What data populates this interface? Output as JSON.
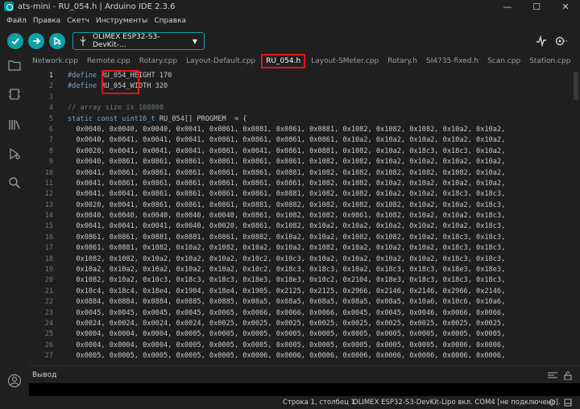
{
  "window": {
    "title": "ats-mini - RU_054.h | Arduino IDE 2.3.6",
    "minimize": "—",
    "maximize": "☐",
    "close": "✕"
  },
  "menu": [
    "Файл",
    "Правка",
    "Скетч",
    "Инструменты",
    "Справка"
  ],
  "toolbar": {
    "board": "OLIMEX ESP32-S3-DevKit-..."
  },
  "tabs": [
    {
      "label": "Network.cpp"
    },
    {
      "label": "Remote.cpp"
    },
    {
      "label": "Rotary.cpp"
    },
    {
      "label": "Layout-Default.cpp"
    },
    {
      "label": "RU_054.h",
      "active": true
    },
    {
      "label": "Layout-SMeter.cpp"
    },
    {
      "label": "Rotary.h"
    },
    {
      "label": "SI4735-fixed.h"
    },
    {
      "label": "Scan.cpp"
    },
    {
      "label": "Station.cpp"
    }
  ],
  "editor": {
    "line_numbers": [
      "1",
      "2",
      "3",
      "4",
      "5",
      "6",
      "7",
      "8",
      "9",
      "10",
      "11",
      "12",
      "13",
      "14",
      "15",
      "16",
      "17",
      "18",
      "19",
      "20",
      "21",
      "22",
      "23",
      "24",
      "25",
      "26",
      "27"
    ],
    "lines": [
      "#define RU_054_HEIGHT 170",
      "#define RU_054_WIDTH 320",
      "",
      "// array size is 108800",
      "static const uint16_t RU_054[] PROGMEM  = {",
      "  0x0040, 0x0040, 0x0040, 0x0041, 0x0861, 0x0881, 0x0861, 0x0881, 0x1082, 0x1082, 0x1082, 0x10a2, 0x10a2,",
      "  0x0040, 0x0041, 0x0041, 0x0041, 0x0861, 0x0861, 0x0861, 0x0861, 0x10a2, 0x10a2, 0x10a2, 0x10a2, 0x10a2,",
      "  0x0020, 0x0041, 0x0041, 0x0041, 0x0861, 0x0041, 0x0861, 0x0881, 0x1082, 0x10a2, 0x18c3, 0x18c3, 0x10a2,",
      "  0x0040, 0x0861, 0x0861, 0x0861, 0x0861, 0x0861, 0x0861, 0x1082, 0x1082, 0x10a2, 0x10a2, 0x10a2, 0x10a2,",
      "  0x0041, 0x0861, 0x0861, 0x0861, 0x0861, 0x0861, 0x0881, 0x1082, 0x1082, 0x1082, 0x1082, 0x1082, 0x10a2,",
      "  0x0041, 0x0861, 0x0861, 0x0861, 0x0861, 0x0861, 0x0861, 0x1082, 0x1082, 0x10a2, 0x10a2, 0x10a2, 0x10a2,",
      "  0x0041, 0x0041, 0x0861, 0x0861, 0x0861, 0x0861, 0x0881, 0x1082, 0x1082, 0x10a2, 0x10a2, 0x18c3, 0x18c3,",
      "  0x0020, 0x0041, 0x0861, 0x0861, 0x0861, 0x0881, 0x0882, 0x1082, 0x1082, 0x1082, 0x10a2, 0x10a2, 0x18c3,",
      "  0x0040, 0x0040, 0x0040, 0x0040, 0x0040, 0x0861, 0x1082, 0x1082, 0x0861, 0x1082, 0x10a2, 0x10a2, 0x18c3,",
      "  0x0041, 0x0041, 0x0041, 0x0040, 0x0020, 0x0861, 0x1082, 0x10a2, 0x10a2, 0x10a2, 0x10a2, 0x10a2, 0x18c3,",
      "  0x0861, 0x0861, 0x0881, 0x0881, 0x0861, 0x0882, 0x10a2, 0x10a2, 0x1082, 0x1082, 0x10a2, 0x18c3, 0x18c3,",
      "  0x0861, 0x0881, 0x1082, 0x10a2, 0x1082, 0x10a2, 0x10a2, 0x1082, 0x10a2, 0x10a2, 0x10a2, 0x18c3, 0x18c3,",
      "  0x1082, 0x1082, 0x10a2, 0x10a2, 0x10a2, 0x10c2, 0x10c3, 0x10a2, 0x10a2, 0x10a2, 0x10a2, 0x18c3, 0x18c3,",
      "  0x10a2, 0x10a2, 0x10a2, 0x10a2, 0x10a2, 0x10c2, 0x18c3, 0x18c3, 0x10a2, 0x18c3, 0x18c3, 0x18e3, 0x18e3,",
      "  0x1082, 0x10a2, 0x10c3, 0x18c3, 0x18c3, 0x18e3, 0x18e3, 0x10c2, 0x2104, 0x18e3, 0x18c3, 0x18c3, 0x18c3,",
      "  0x10c4, 0x18c4, 0x18e4, 0x1904, 0x18e4, 0x1905, 0x2125, 0x2125, 0x2966, 0x2146, 0x2146, 0x2966, 0x2146,",
      "  0x0884, 0x0884, 0x0884, 0x0885, 0x0885, 0x08a5, 0x08a5, 0x08a5, 0x08a5, 0x08a5, 0x10a6, 0x10c6, 0x10a6,",
      "  0x0045, 0x0045, 0x0045, 0x0045, 0x0065, 0x0066, 0x0066, 0x0066, 0x0045, 0x0045, 0x0046, 0x0066, 0x0066,",
      "  0x0024, 0x0024, 0x0024, 0x0024, 0x0025, 0x0025, 0x0025, 0x0025, 0x0025, 0x0025, 0x0025, 0x0025, 0x0025,",
      "  0x0004, 0x0004, 0x0004, 0x0005, 0x0005, 0x0005, 0x0005, 0x0005, 0x0005, 0x0005, 0x0005, 0x0005, 0x0005,",
      "  0x0004, 0x0004, 0x0004, 0x0005, 0x0005, 0x0005, 0x0005, 0x0005, 0x0005, 0x0005, 0x0005, 0x0006, 0x0006,",
      "  0x0005, 0x0005, 0x0005, 0x0005, 0x0005, 0x0006, 0x0006, 0x0006, 0x0006, 0x0006, 0x0006, 0x0006, 0x0006,"
    ]
  },
  "output": {
    "title": "Вывод"
  },
  "status": {
    "position": "Строка 1, столбец 1",
    "board": "OLIMEX ESP32-S3-DevKit-Lipo вкл. COM4 [не подключено]."
  }
}
